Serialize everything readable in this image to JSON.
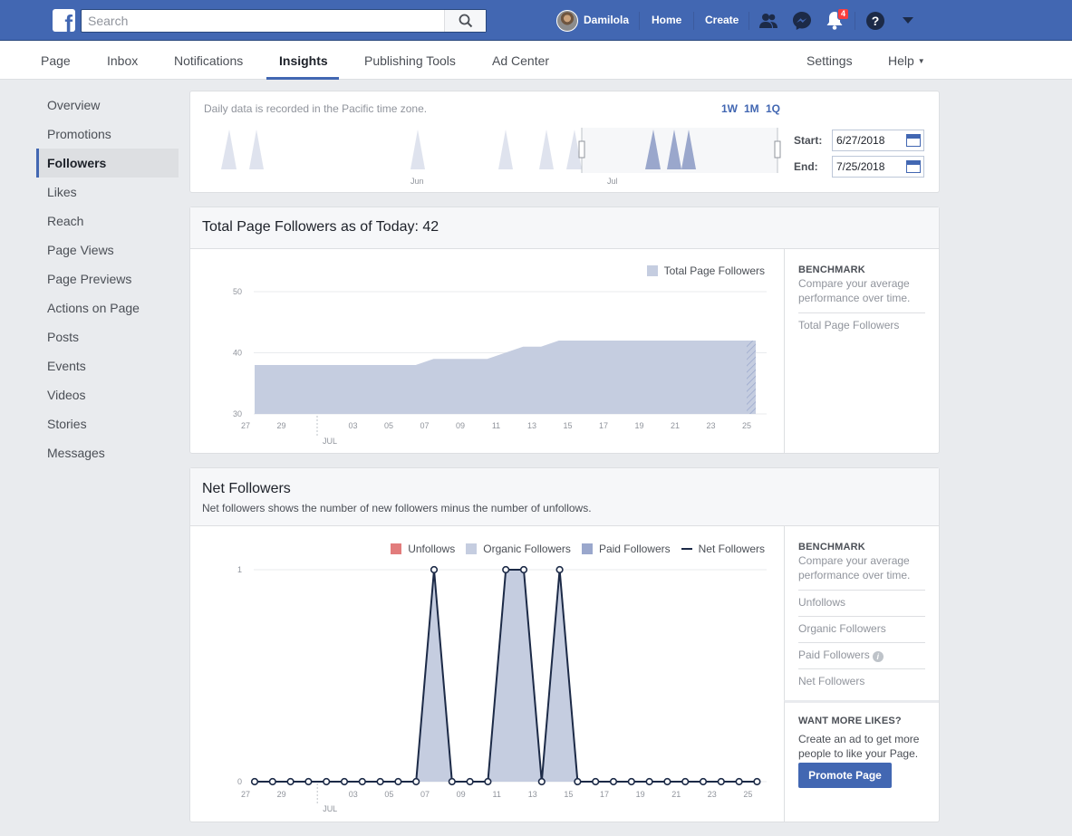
{
  "topbar": {
    "search_placeholder": "Search",
    "user_name": "Damilola",
    "home": "Home",
    "create": "Create",
    "notification_count": "4",
    "colors": {
      "bar": "#4267b2",
      "badge": "#fa3e3e"
    }
  },
  "page_nav": {
    "tabs": [
      "Page",
      "Inbox",
      "Notifications",
      "Insights",
      "Publishing Tools",
      "Ad Center"
    ],
    "active_tab": "Insights",
    "settings": "Settings",
    "help": "Help"
  },
  "sidebar": {
    "items": [
      "Overview",
      "Promotions",
      "Followers",
      "Likes",
      "Reach",
      "Page Views",
      "Page Previews",
      "Actions on Page",
      "Posts",
      "Events",
      "Videos",
      "Stories",
      "Messages"
    ],
    "active": "Followers"
  },
  "date_range": {
    "note": "Daily data is recorded in the Pacific time zone.",
    "ranges": [
      "1W",
      "1M",
      "1Q"
    ],
    "start_label": "Start:",
    "start": "6/27/2018",
    "end_label": "End:",
    "end": "7/25/2018",
    "timeline_labels": [
      "Jun",
      "Jul"
    ]
  },
  "total_followers": {
    "title": "Total Page Followers as of Today: 42",
    "benchmark_head": "BENCHMARK",
    "benchmark_desc": "Compare your average performance over time.",
    "benchmark_items": [
      "Total Page Followers"
    ]
  },
  "net_followers": {
    "title": "Net Followers",
    "subtitle": "Net followers shows the number of new followers minus the number of unfollows.",
    "benchmark_head": "BENCHMARK",
    "benchmark_desc": "Compare your average performance over time.",
    "benchmark_items": [
      "Unfollows",
      "Organic Followers",
      "Paid Followers",
      "Net Followers"
    ],
    "promo_head": "WANT MORE LIKES?",
    "promo_desc": "Create an ad to get more people to like your Page.",
    "promo_button": "Promote Page"
  },
  "chart_data": [
    {
      "type": "area",
      "title": "Total Page Followers as of Today: 42",
      "series": [
        {
          "name": "Total Page Followers",
          "color": "#c5cde0",
          "values": [
            38,
            38,
            38,
            38,
            38,
            38,
            38,
            38,
            38,
            38,
            39,
            39,
            39,
            39,
            40,
            41,
            41,
            42,
            42,
            42,
            42,
            42,
            42,
            42,
            42,
            42,
            42,
            42,
            42
          ]
        }
      ],
      "x": [
        "6/27",
        "6/28",
        "6/29",
        "6/30",
        "7/1",
        "7/2",
        "7/3",
        "7/4",
        "7/5",
        "7/6",
        "7/7",
        "7/8",
        "7/9",
        "7/10",
        "7/11",
        "7/12",
        "7/13",
        "7/14",
        "7/15",
        "7/16",
        "7/17",
        "7/18",
        "7/19",
        "7/20",
        "7/21",
        "7/22",
        "7/23",
        "7/24",
        "7/25"
      ],
      "x_tick_labels": [
        "27",
        "29",
        "03",
        "05",
        "07",
        "09",
        "11",
        "13",
        "15",
        "17",
        "19",
        "21",
        "23",
        "25"
      ],
      "x_month_label": "JUL",
      "ylim": [
        30,
        50
      ],
      "y_ticks": [
        30,
        40,
        50
      ],
      "legend": "top-right"
    },
    {
      "type": "line",
      "title": "Net Followers",
      "series": [
        {
          "name": "Unfollows",
          "color": "#e27c7c",
          "values": [
            0,
            0,
            0,
            0,
            0,
            0,
            0,
            0,
            0,
            0,
            0,
            0,
            0,
            0,
            0,
            0,
            0,
            0,
            0,
            0,
            0,
            0,
            0,
            0,
            0,
            0,
            0,
            0,
            0
          ]
        },
        {
          "name": "Organic Followers",
          "color": "#c5cde0",
          "values": [
            0,
            0,
            0,
            0,
            0,
            0,
            0,
            0,
            0,
            0,
            1,
            0,
            0,
            0,
            1,
            1,
            0,
            1,
            0,
            0,
            0,
            0,
            0,
            0,
            0,
            0,
            0,
            0,
            0
          ]
        },
        {
          "name": "Paid Followers",
          "color": "#9aa7cc",
          "values": [
            0,
            0,
            0,
            0,
            0,
            0,
            0,
            0,
            0,
            0,
            0,
            0,
            0,
            0,
            0,
            0,
            0,
            0,
            0,
            0,
            0,
            0,
            0,
            0,
            0,
            0,
            0,
            0,
            0
          ]
        },
        {
          "name": "Net Followers",
          "color": "#1c2a47",
          "values": [
            0,
            0,
            0,
            0,
            0,
            0,
            0,
            0,
            0,
            0,
            1,
            0,
            0,
            0,
            1,
            1,
            0,
            1,
            0,
            0,
            0,
            0,
            0,
            0,
            0,
            0,
            0,
            0,
            0
          ]
        }
      ],
      "x_tick_labels": [
        "27",
        "29",
        "03",
        "05",
        "07",
        "09",
        "11",
        "13",
        "15",
        "17",
        "19",
        "21",
        "23",
        "25"
      ],
      "x_month_label": "JUL",
      "ylim": [
        0,
        1
      ],
      "y_ticks": [
        0,
        1
      ],
      "legend": "top-right"
    }
  ]
}
